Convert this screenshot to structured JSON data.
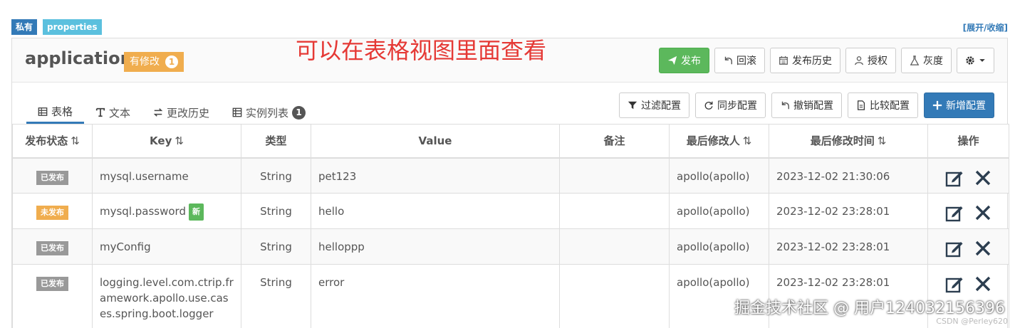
{
  "tags": {
    "private": "私有",
    "format": "properties"
  },
  "expand_link": "[展开/收缩]",
  "namespace": {
    "title": "application",
    "modified_label": "有修改",
    "modified_count": "1"
  },
  "overlay_note": "可以在表格视图里面查看",
  "head_actions": {
    "publish": "发布",
    "rollback": "回滚",
    "publish_history": "发布历史",
    "authorize": "授权",
    "gray": "灰度"
  },
  "tabs": [
    {
      "label": "表格",
      "icon": "table-icon"
    },
    {
      "label": "文本",
      "icon": "text-icon"
    },
    {
      "label": "更改历史",
      "icon": "history-icon"
    },
    {
      "label": "实例列表",
      "icon": "instances-icon",
      "count": "1"
    }
  ],
  "tab_actions": {
    "filter": "过滤配置",
    "sync": "同步配置",
    "revoke": "撤销配置",
    "compare": "比较配置",
    "add": "新增配置"
  },
  "table": {
    "headers": {
      "status": "发布状态",
      "key": "Key",
      "type": "类型",
      "value": "Value",
      "comment": "备注",
      "modifier": "最后修改人",
      "modified_time": "最后修改时间",
      "actions": "操作"
    },
    "rows": [
      {
        "status": "已发布",
        "key": "mysql.username",
        "type": "String",
        "value": "pet123",
        "comment": "",
        "modifier": "apollo(apollo)",
        "time": "2023-12-02 21:30:06"
      },
      {
        "status": "未发布",
        "key": "mysql.password",
        "new_badge": "新",
        "type": "String",
        "value": "hello",
        "comment": "",
        "modifier": "apollo(apollo)",
        "time": "2023-12-02 23:28:01"
      },
      {
        "status": "已发布",
        "key": "myConfig",
        "type": "String",
        "value": "helloppp",
        "comment": "",
        "modifier": "apollo(apollo)",
        "time": "2023-12-02 23:28:01"
      },
      {
        "status": "已发布",
        "key": "logging.level.com.ctrip.framework.apollo.use.cases.spring.boot.logger",
        "type": "String",
        "value": "error",
        "comment": "",
        "modifier": "apollo(apollo)",
        "time": "2023-12-02 23:28:01"
      }
    ]
  },
  "watermark": "掘金技术社区 @ 用户124032156396",
  "watermark_small": "CSDN @Perley620",
  "colors": {
    "primary": "#337ab7",
    "success": "#5cb85c",
    "warning": "#f0ad4e",
    "info": "#5bc0de",
    "muted": "#999999",
    "note_red": "#e53935"
  }
}
